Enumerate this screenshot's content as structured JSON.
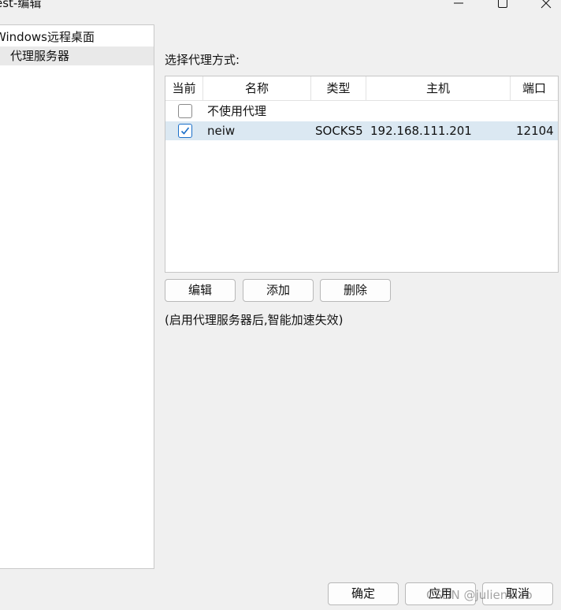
{
  "window": {
    "title": "est-编辑"
  },
  "tree": {
    "items": [
      {
        "label": "Windows远程桌面"
      },
      {
        "label": "代理服务器"
      }
    ]
  },
  "proxy": {
    "section_label": "选择代理方式:",
    "columns": [
      "当前",
      "名称",
      "类型",
      "主机",
      "端口"
    ],
    "rows": [
      {
        "checked": false,
        "name": "不使用代理",
        "type": "",
        "host": "",
        "port": ""
      },
      {
        "checked": true,
        "name": "neiw",
        "type": "SOCKS5",
        "host": "192.168.111.201",
        "port": "12104"
      }
    ],
    "buttons": {
      "edit": "编辑",
      "add": "添加",
      "delete": "删除"
    },
    "note": "(启用代理服务器后,智能加速失效)"
  },
  "footer": {
    "ok": "确定",
    "apply": "应用",
    "cancel": "取消"
  },
  "watermark": "CSDN @julienxiao",
  "colors": {
    "selected_row": "#dbe8f2",
    "checkbox_accent": "#1a6fc9"
  }
}
